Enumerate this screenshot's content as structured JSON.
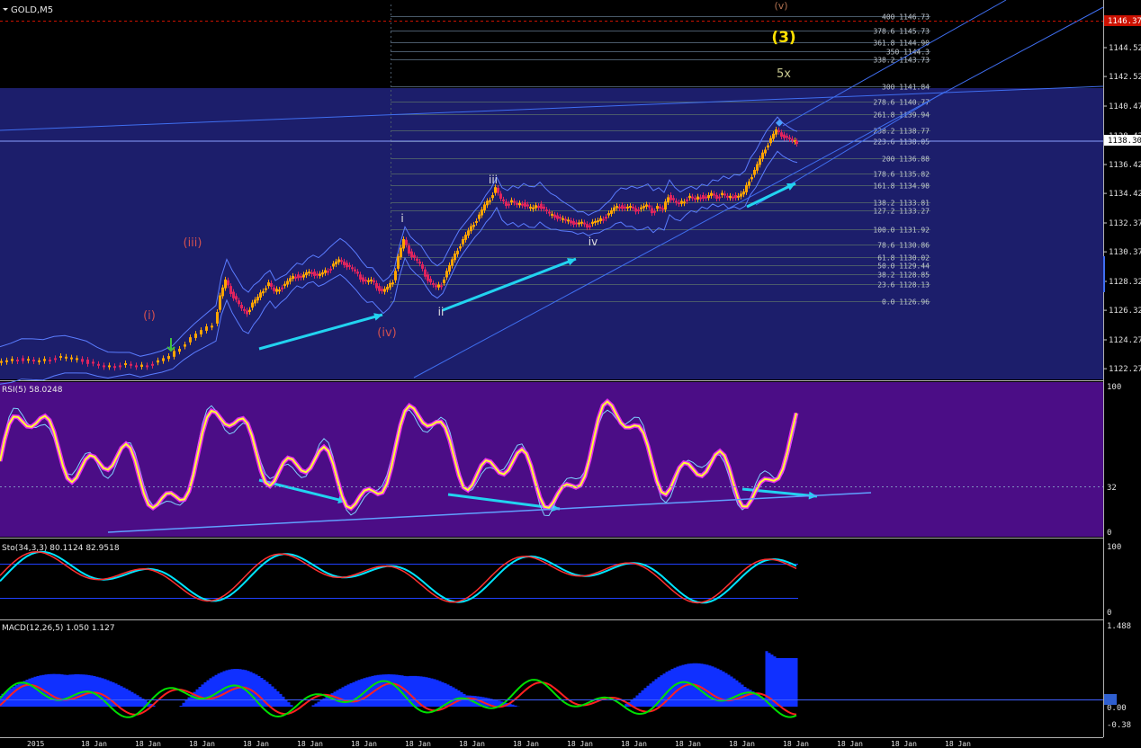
{
  "symbol_label": "GOLD,M5",
  "colors": {
    "bg": "#000000",
    "main_band": "#1c1e6b",
    "rsi_band": "#4b0d86",
    "candle_up": "#ffa500",
    "candle_down": "#e0245e",
    "grid": "#5a5f7a",
    "fib": "#4a5a6a",
    "channel": "#3f6ef0",
    "price_marker": "#cc1100",
    "cyan_arrow": "#22d3f0",
    "rsi_line": "#ffff33",
    "rsi_glow": "#ff33ff",
    "sto_main": "#ff3030",
    "sto_signal": "#00e5ff",
    "macd_hist": "#1030ff",
    "macd_line": "#00e000",
    "macd_signal": "#ff2020"
  },
  "price_axis": {
    "ticks": [
      "1144.52",
      "1142.52",
      "1140.47",
      "1138.42",
      "1136.42",
      "1134.42",
      "1132.37",
      "1130.37",
      "1128.32",
      "1126.32",
      "1124.27",
      "1122.27"
    ],
    "red_marker": "1146.37",
    "current": "1138.30"
  },
  "fib_levels": [
    {
      "label": "400 1146.73",
      "price": 1146.73
    },
    {
      "label": "378.6 1145.73",
      "price": 1145.73
    },
    {
      "label": "361.8 1144.90",
      "price": 1144.9
    },
    {
      "label": "350 1144.3",
      "price": 1144.3
    },
    {
      "label": "338.2 1143.73",
      "price": 1143.73
    },
    {
      "label": "300 1141.84",
      "price": 1141.84
    },
    {
      "label": "278.6 1140.77",
      "price": 1140.77
    },
    {
      "label": "261.8 1139.94",
      "price": 1139.94
    },
    {
      "label": "238.2 1138.77",
      "price": 1138.77
    },
    {
      "label": "223.6 1138.05",
      "price": 1138.05
    },
    {
      "label": "200 1136.88",
      "price": 1136.88
    },
    {
      "label": "178.6 1135.82",
      "price": 1135.82
    },
    {
      "label": "161.8 1134.98",
      "price": 1134.98
    },
    {
      "label": "138.2 1133.81",
      "price": 1133.81
    },
    {
      "label": "127.2 1133.27",
      "price": 1133.27
    },
    {
      "label": "100.0 1131.92",
      "price": 1131.92
    },
    {
      "label": "78.6 1130.86",
      "price": 1130.86
    },
    {
      "label": "61.8 1130.02",
      "price": 1130.02
    },
    {
      "label": "50.0 1129.44",
      "price": 1129.44
    },
    {
      "label": "38.2 1128.85",
      "price": 1128.85
    },
    {
      "label": "23.6 1128.13",
      "price": 1128.13
    },
    {
      "label": "0.0 1126.96",
      "price": 1126.96
    }
  ],
  "wave_labels": [
    {
      "text": "(v)",
      "color": "#b07050"
    },
    {
      "text": "(3)",
      "color": "#ffe000"
    },
    {
      "text": "5x",
      "color": "#c8c890"
    },
    {
      "text": "(iii)",
      "color": "#d05050"
    },
    {
      "text": "(i)",
      "color": "#d05050"
    },
    {
      "text": "(iv)",
      "color": "#d05050"
    },
    {
      "text": "i",
      "color": "#e0e0e0"
    },
    {
      "text": "ii",
      "color": "#e0e0e0"
    },
    {
      "text": "iii",
      "color": "#e0e0e0"
    },
    {
      "text": "iv",
      "color": "#e0e0e0"
    }
  ],
  "rsi": {
    "label": "RSI(5) 58.0248",
    "ticks": [
      "100",
      "32",
      "0"
    ]
  },
  "sto": {
    "label": "Sto(34,3,3) 80.1124 82.9518",
    "ticks": [
      "100",
      "0"
    ]
  },
  "macd": {
    "label": "MACD(12,26,5) 1.050 1.127",
    "ticks": [
      "1.488",
      "0.00",
      "-0.38"
    ]
  },
  "time_axis": [
    "2015",
    "18 Jan",
    "18 Jan",
    "18 Jan",
    "18 Jan",
    "18 Jan",
    "18 Jan",
    "18 Jan",
    "18 Jan",
    "18 Jan",
    "18 Jan",
    "18 Jan",
    "18 Jan",
    "18 Jan",
    "18 Jan",
    "18 Jan",
    "18 Jan",
    "18 Jan"
  ],
  "chart_data": {
    "type": "candlestick",
    "title": "GOLD,M5",
    "price_range": [
      1122.27,
      1146.73
    ],
    "close_path": [
      [
        0,
        1122.7
      ],
      [
        12,
        1122.8
      ],
      [
        24,
        1123.0
      ],
      [
        36,
        1122.9
      ],
      [
        48,
        1122.8
      ],
      [
        60,
        1123.0
      ],
      [
        72,
        1123.1
      ],
      [
        84,
        1123.0
      ],
      [
        96,
        1122.9
      ],
      [
        108,
        1122.6
      ],
      [
        120,
        1122.4
      ],
      [
        132,
        1122.5
      ],
      [
        144,
        1122.6
      ],
      [
        156,
        1122.4
      ],
      [
        168,
        1122.6
      ],
      [
        180,
        1122.8
      ],
      [
        192,
        1123.1
      ],
      [
        204,
        1123.8
      ],
      [
        216,
        1124.4
      ],
      [
        228,
        1124.9
      ],
      [
        240,
        1125.4
      ],
      [
        246,
        1127.3
      ],
      [
        252,
        1128.4
      ],
      [
        258,
        1127.6
      ],
      [
        264,
        1127.0
      ],
      [
        270,
        1126.4
      ],
      [
        276,
        1126.2
      ],
      [
        282,
        1126.8
      ],
      [
        288,
        1127.2
      ],
      [
        294,
        1127.8
      ],
      [
        300,
        1128.2
      ],
      [
        306,
        1127.6
      ],
      [
        312,
        1127.9
      ],
      [
        318,
        1128.1
      ],
      [
        324,
        1128.5
      ],
      [
        330,
        1128.8
      ],
      [
        336,
        1128.6
      ],
      [
        342,
        1128.9
      ],
      [
        348,
        1129.0
      ],
      [
        354,
        1128.7
      ],
      [
        360,
        1128.9
      ],
      [
        366,
        1129.2
      ],
      [
        372,
        1129.5
      ],
      [
        378,
        1129.8
      ],
      [
        384,
        1129.6
      ],
      [
        390,
        1129.3
      ],
      [
        396,
        1129.0
      ],
      [
        402,
        1128.6
      ],
      [
        408,
        1128.3
      ],
      [
        414,
        1128.4
      ],
      [
        420,
        1128.0
      ],
      [
        426,
        1127.6
      ],
      [
        432,
        1127.9
      ],
      [
        438,
        1128.4
      ],
      [
        444,
        1130.0
      ],
      [
        450,
        1131.2
      ],
      [
        456,
        1130.4
      ],
      [
        462,
        1129.9
      ],
      [
        468,
        1129.5
      ],
      [
        474,
        1128.8
      ],
      [
        480,
        1128.2
      ],
      [
        486,
        1127.9
      ],
      [
        492,
        1128.2
      ],
      [
        498,
        1129.0
      ],
      [
        504,
        1129.8
      ],
      [
        510,
        1130.6
      ],
      [
        516,
        1131.2
      ],
      [
        522,
        1131.8
      ],
      [
        528,
        1132.4
      ],
      [
        534,
        1132.9
      ],
      [
        540,
        1133.6
      ],
      [
        546,
        1134.1
      ],
      [
        552,
        1134.8
      ],
      [
        558,
        1134.0
      ],
      [
        564,
        1133.7
      ],
      [
        570,
        1133.9
      ],
      [
        576,
        1133.6
      ],
      [
        582,
        1133.8
      ],
      [
        588,
        1133.5
      ],
      [
        594,
        1133.4
      ],
      [
        600,
        1133.7
      ],
      [
        606,
        1133.3
      ],
      [
        612,
        1133.0
      ],
      [
        618,
        1132.9
      ],
      [
        624,
        1132.7
      ],
      [
        630,
        1132.6
      ],
      [
        636,
        1132.5
      ],
      [
        642,
        1132.3
      ],
      [
        648,
        1132.4
      ],
      [
        654,
        1132.2
      ],
      [
        660,
        1132.4
      ],
      [
        666,
        1132.5
      ],
      [
        672,
        1132.8
      ],
      [
        678,
        1133.0
      ],
      [
        684,
        1133.4
      ],
      [
        690,
        1133.6
      ],
      [
        696,
        1133.4
      ],
      [
        702,
        1133.5
      ],
      [
        708,
        1133.3
      ],
      [
        714,
        1133.4
      ],
      [
        720,
        1133.6
      ],
      [
        726,
        1133.2
      ],
      [
        732,
        1133.5
      ],
      [
        738,
        1133.3
      ],
      [
        744,
        1134.3
      ],
      [
        750,
        1133.9
      ],
      [
        756,
        1133.7
      ],
      [
        762,
        1134.0
      ],
      [
        768,
        1134.2
      ],
      [
        774,
        1134.0
      ],
      [
        780,
        1134.3
      ],
      [
        786,
        1134.1
      ],
      [
        792,
        1134.4
      ],
      [
        798,
        1134.2
      ],
      [
        804,
        1134.4
      ],
      [
        810,
        1134.1
      ],
      [
        816,
        1134.3
      ],
      [
        822,
        1134.2
      ],
      [
        828,
        1134.5
      ],
      [
        834,
        1135.4
      ],
      [
        840,
        1136.0
      ],
      [
        846,
        1136.8
      ],
      [
        852,
        1137.6
      ],
      [
        858,
        1138.2
      ],
      [
        864,
        1138.8
      ],
      [
        870,
        1138.5
      ],
      [
        876,
        1138.3
      ],
      [
        882,
        1138.1
      ],
      [
        886,
        1138.0
      ]
    ],
    "annotation_points": {
      "blue_star_price": 1139.3
    }
  }
}
